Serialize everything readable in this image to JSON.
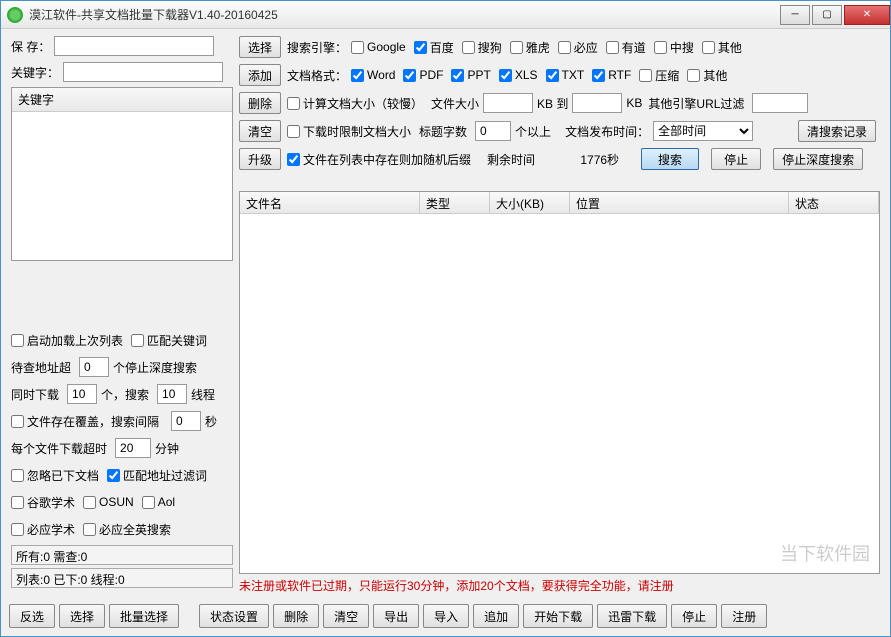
{
  "window": {
    "title": "漠江软件-共享文档批量下载器V1.40-20160425"
  },
  "left": {
    "save_label": "保 存：",
    "save_value": "",
    "keyword_label": "关键字：",
    "keyword_value": "",
    "kw_header": "关键字"
  },
  "side_buttons": {
    "select": "选择",
    "add": "添加",
    "delete": "删除",
    "clear": "清空",
    "upgrade": "升级"
  },
  "engine": {
    "label": "搜索引擎：",
    "google": "Google",
    "baidu": "百度",
    "sogou": "搜狗",
    "yahoo": "雅虎",
    "bing": "必应",
    "youdao": "有道",
    "zhongsou": "中搜",
    "other": "其他"
  },
  "format": {
    "label": "文档格式：",
    "word": "Word",
    "pdf": "PDF",
    "ppt": "PPT",
    "xls": "XLS",
    "txt": "TXT",
    "rtf": "RTF",
    "zip": "压缩",
    "other": "其他"
  },
  "size": {
    "calc": "计算文档大小（较慢）",
    "label": "文件大小",
    "kb_to": "KB 到",
    "kb": "KB",
    "other_url": "其他引擎URL过滤"
  },
  "limit": {
    "download_limit": "下载时限制文档大小",
    "title_words": "标题字数",
    "title_val": "0",
    "above": "个以上",
    "pub_time": "文档发布时间：",
    "pub_sel": "全部时间",
    "clear_history": "清搜索记录"
  },
  "file_row": {
    "exists": "文件在列表中存在则加随机后缀",
    "remain_label": "剩余时间",
    "remain_val": "1776秒",
    "search": "搜索",
    "stop": "停止",
    "stop_deep": "停止深度搜索"
  },
  "table": {
    "filename": "文件名",
    "type": "类型",
    "size": "大小(KB)",
    "location": "位置",
    "status": "状态"
  },
  "left_opts": {
    "load_last": "启动加载上次列表",
    "match_kw": "匹配关键词",
    "pending_addr": "待查地址超",
    "pending_val": "0",
    "stop_deep": "个停止深度搜索",
    "concurrent_dl": "同时下载",
    "dl_val": "10",
    "ge": "个，搜索",
    "search_val": "10",
    "threads": "线程",
    "overwrite": "文件存在覆盖，搜索间隔",
    "interval_val": "0",
    "sec": "秒",
    "each_timeout": "每个文件下载超时",
    "timeout_val": "20",
    "minutes": "分钟",
    "ignore_downloaded": "忽略已下文档",
    "match_url_filter": "匹配地址过滤词",
    "google_scholar": "谷歌学术",
    "osun": "OSUN",
    "aol": "Aol",
    "bing_scholar": "必应学术",
    "bing_uk": "必应全英搜索",
    "status1": "所有:0 需查:0",
    "status2": "列表:0 已下:0 线程:0"
  },
  "notice": "未注册或软件已过期，只能运行30分钟，添加20个文档，要获得完全功能，请注册",
  "bottom": {
    "invert": "反选",
    "select": "选择",
    "batch": "批量选择",
    "state": "状态设置",
    "delete": "删除",
    "clear": "清空",
    "export": "导出",
    "import": "导入",
    "append": "追加",
    "start": "开始下载",
    "xunlei": "迅雷下载",
    "stop": "停止",
    "register": "注册"
  },
  "watermark": "当下软件园"
}
